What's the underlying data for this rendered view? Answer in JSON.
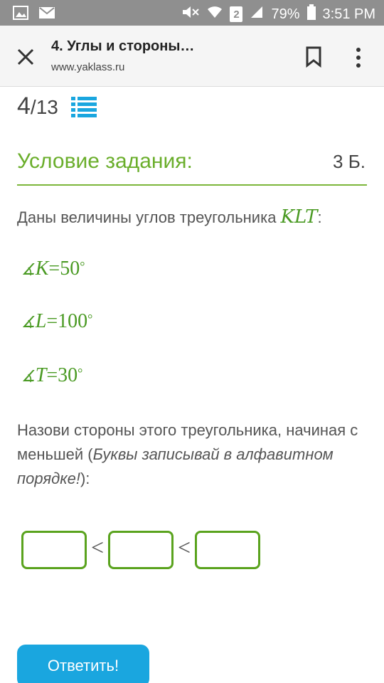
{
  "status_bar": {
    "battery": "79%",
    "time": "3:51 PM",
    "sim_badge": "2"
  },
  "browser": {
    "title": "4. Углы и стороны…",
    "url": "www.yaklass.ru"
  },
  "progress": {
    "current": "4",
    "separator_total": "/13"
  },
  "task": {
    "section_title": "Условие задания:",
    "points": "3 Б.",
    "given_text": "Даны величины углов треугольника ",
    "triangle": "KLT",
    "given_colon": ":",
    "angles": [
      {
        "symbol": "∡",
        "vertex": "K",
        "eq": "=",
        "value": "50",
        "deg": "°"
      },
      {
        "symbol": "∡",
        "vertex": "L",
        "eq": "=",
        "value": "100",
        "deg": "°"
      },
      {
        "symbol": "∡",
        "vertex": "T",
        "eq": "=",
        "value": "30",
        "deg": "°"
      }
    ],
    "instruction_start": "Назови стороны этого треугольника, начиная с меньшей (",
    "instruction_italic": "Буквы записывай в алфавитном порядке!",
    "instruction_end": "):",
    "lt_symbol": "<"
  },
  "submit_label": "Ответить!",
  "colors": {
    "accent_green": "#6aae2b",
    "box_border": "#5aa31e",
    "button_blue": "#1aa6df"
  }
}
